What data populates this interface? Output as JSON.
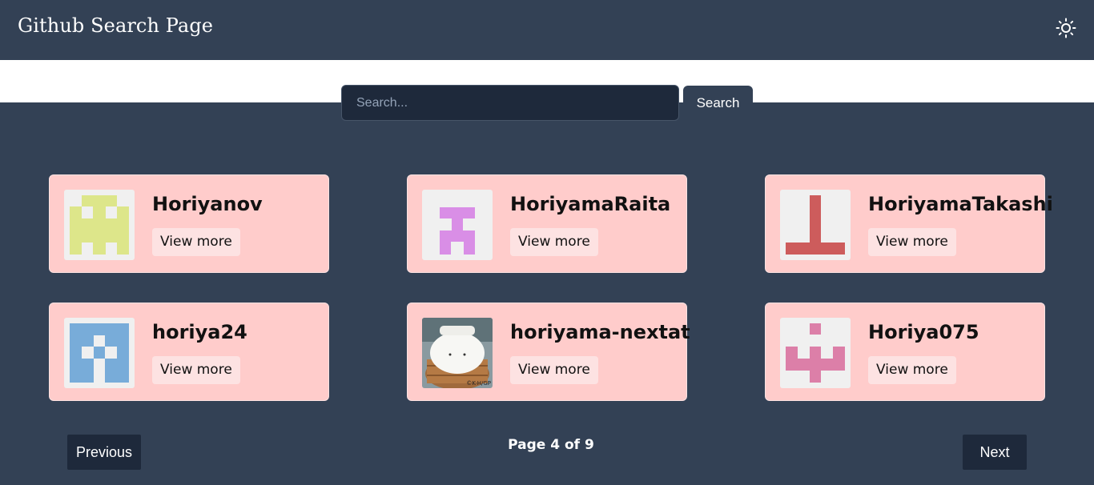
{
  "header": {
    "title": "Github Search Page",
    "theme_icon": "sun-icon"
  },
  "search": {
    "placeholder": "Search...",
    "value": "",
    "button_label": "Search"
  },
  "results": [
    {
      "username": "Horiyanov",
      "button_label": "View more",
      "avatar_icon": "identicon-green",
      "avatar_color": "#dde68a"
    },
    {
      "username": "HoriyamaRaita",
      "button_label": "View more",
      "avatar_icon": "identicon-purple",
      "avatar_color": "#d98ee6"
    },
    {
      "username": "HoriyamaTakashi",
      "button_label": "View more",
      "avatar_icon": "identicon-red",
      "avatar_color": "#cd5c5c"
    },
    {
      "username": "horiya24",
      "button_label": "View more",
      "avatar_icon": "identicon-blue",
      "avatar_color": "#78acd9"
    },
    {
      "username": "horiyama-nextat",
      "button_label": "View more",
      "avatar_icon": "photo-avatar"
    },
    {
      "username": "Horiya075",
      "button_label": "View more",
      "avatar_icon": "identicon-pink",
      "avatar_color": "#dc7fa8"
    }
  ],
  "pagination": {
    "previous_label": "Previous",
    "next_label": "Next",
    "page_text": "Page 4 of 9"
  },
  "colors": {
    "background": "#334155",
    "card": "#ffcccb",
    "input": "#1e293b"
  }
}
